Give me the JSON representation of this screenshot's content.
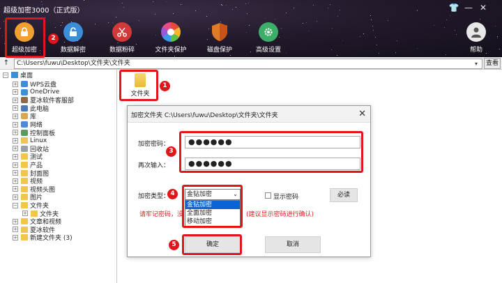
{
  "window": {
    "title": "超级加密3000（正式版）",
    "controls": [
      {
        "name": "skin-icon",
        "glyph": "👕"
      },
      {
        "name": "minimize-icon",
        "glyph": "—"
      },
      {
        "name": "close-icon",
        "glyph": "✕"
      }
    ]
  },
  "toolbar": {
    "items": [
      {
        "id": "super-encrypt",
        "label": "超级加密",
        "icon": "lock-icon",
        "color": "#f0a030"
      },
      {
        "id": "data-decrypt",
        "label": "数据解密",
        "icon": "unlock-icon",
        "color": "#3a8fd8"
      },
      {
        "id": "data-shred",
        "label": "数据粉碎",
        "icon": "scissors-icon",
        "color": "#d23a3a"
      },
      {
        "id": "file-protect",
        "label": "文件夹保护",
        "icon": "aperture-icon",
        "color": "#e8e8e8"
      },
      {
        "id": "disk-protect",
        "label": "磁盘保护",
        "icon": "shield-icon",
        "color": "#e07a26"
      },
      {
        "id": "advanced",
        "label": "高级设置",
        "icon": "gear-icon",
        "color": "#3cae6a"
      }
    ],
    "help_label": "帮助"
  },
  "address": {
    "path": "C:\\Users\\fuwu\\Desktop\\文件夹\\文件夹",
    "view_label": "查看"
  },
  "tree": {
    "root": "桌面",
    "nodes": [
      {
        "label": "WPS云盘",
        "icon": "cloud-icon"
      },
      {
        "label": "OneDrive",
        "icon": "cloud-icon"
      },
      {
        "label": "夏冰软件客服部",
        "icon": "user-icon"
      },
      {
        "label": "此电脑",
        "icon": "computer-icon"
      },
      {
        "label": "库",
        "icon": "library-icon"
      },
      {
        "label": "网络",
        "icon": "network-icon"
      },
      {
        "label": "控制面板",
        "icon": "control-panel-icon"
      },
      {
        "label": "Linux",
        "icon": "folder-icon"
      },
      {
        "label": "回收站",
        "icon": "recycle-bin-icon"
      },
      {
        "label": "测试",
        "icon": "folder-icon"
      },
      {
        "label": "产品",
        "icon": "folder-icon"
      },
      {
        "label": "封面图",
        "icon": "folder-icon"
      },
      {
        "label": "视频",
        "icon": "folder-icon"
      },
      {
        "label": "视频头图",
        "icon": "folder-icon"
      },
      {
        "label": "图片",
        "icon": "folder-icon"
      },
      {
        "label": "文件夹",
        "icon": "folder-icon"
      },
      {
        "label": "文件夹",
        "icon": "folder-icon"
      },
      {
        "label": "文章和视频",
        "icon": "folder-icon"
      },
      {
        "label": "夏冰软件",
        "icon": "folder-icon"
      },
      {
        "label": "新建文件夹 (3)",
        "icon": "folder-icon"
      }
    ]
  },
  "content": {
    "file_name": "文件夹"
  },
  "dialog": {
    "title": "加密文件夹 C:\\Users\\fuwu\\Desktop\\文件夹\\文件夹",
    "password_label": "加密密码：",
    "password_value": "●●●●●●",
    "confirm_label": "再次输入：",
    "confirm_value": "●●●●●●",
    "type_label": "加密类型：",
    "type_selected": "金钻加密",
    "type_options": [
      "金钻加密",
      "全面加密",
      "移动加密"
    ],
    "show_password_label": "显示密码",
    "must_read_label": "必读",
    "warning": "请牢记密码，没",
    "warning_tail": "(建议显示密码进行确认)",
    "ok_label": "确定",
    "cancel_label": "取消"
  },
  "annotations": [
    "1",
    "2",
    "3",
    "4",
    "5"
  ],
  "colors": {
    "highlight": "#e0161b",
    "selection": "#0a64d6",
    "warning": "#d5241f"
  }
}
